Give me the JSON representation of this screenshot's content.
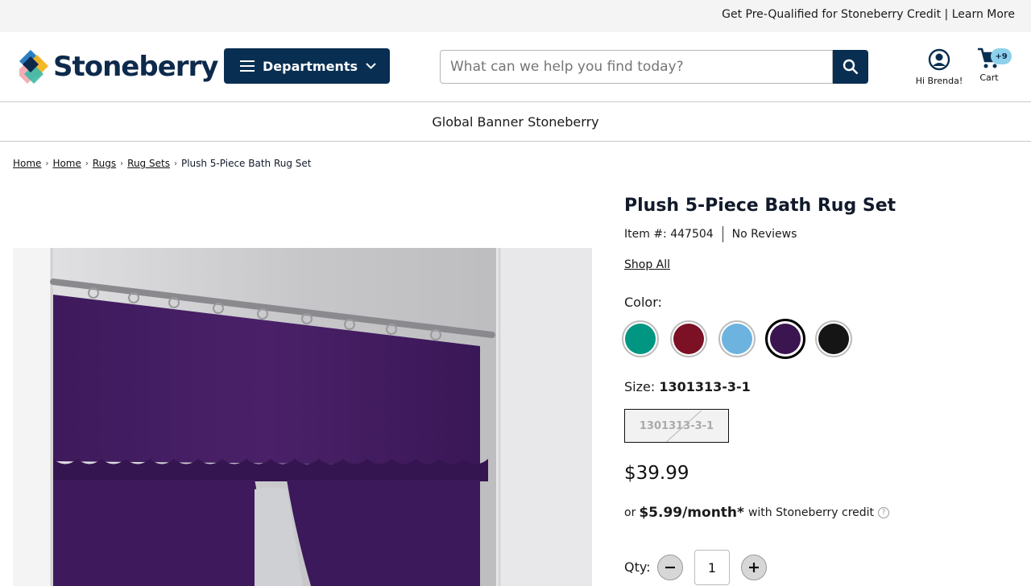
{
  "topbar": {
    "promo": "Get Pre-Qualified for Stoneberry Credit | Learn More"
  },
  "header": {
    "logo_text": "Stoneberry",
    "departments_label": "Departments",
    "search_placeholder": "What can we help you find today?",
    "account_label": "Hi Brenda!",
    "cart_label": "Cart",
    "cart_badge": "+9"
  },
  "banner": {
    "text": "Global Banner Stoneberry"
  },
  "breadcrumb": [
    "Home",
    "Home",
    "Rugs",
    "Rug Sets",
    "Plush 5-Piece Bath Rug Set"
  ],
  "product": {
    "title": "Plush 5-Piece Bath Rug Set",
    "item_number": "Item #: 447504",
    "reviews": "No Reviews",
    "shop_all": "Shop All",
    "color_label": "Color:",
    "colors": [
      {
        "name": "teal",
        "hex": "#009682"
      },
      {
        "name": "burgundy",
        "hex": "#7c1024"
      },
      {
        "name": "light-blue",
        "hex": "#6db3e0"
      },
      {
        "name": "purple",
        "hex": "#3a1550",
        "selected": true
      },
      {
        "name": "black",
        "hex": "#151515"
      }
    ],
    "size_label": "Size:",
    "size_value": "1301313-3-1",
    "size_option": "1301313-3-1",
    "price": "$39.99",
    "credit_prefix": "or",
    "credit_monthly": "$5.99/month*",
    "credit_suffix": "with Stoneberry credit",
    "qty_label": "Qty:",
    "qty_value": "1"
  },
  "colors": {
    "brand_navy": "#082f52",
    "badge": "#8ed1ea",
    "curtain_purple": "#3f1a5c"
  }
}
